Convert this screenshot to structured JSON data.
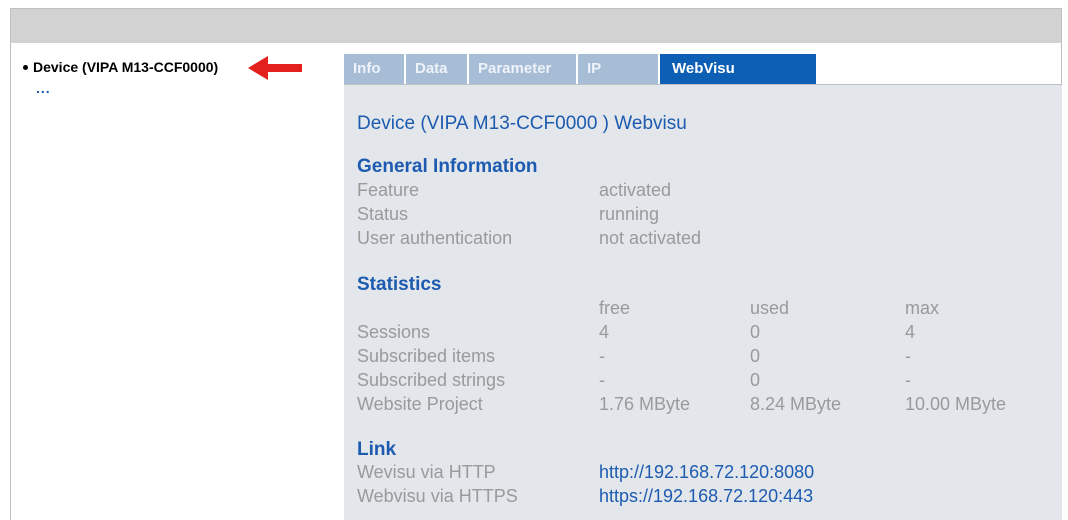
{
  "tree": {
    "device": "Device (VIPA M13-CCF0000)",
    "more": "..."
  },
  "tabs": [
    "Info",
    "Data",
    "Parameter",
    "IP",
    "WebVisu"
  ],
  "active_tab": "WebVisu",
  "panel": {
    "title": "Device (VIPA M13-CCF0000 ) Webvisu",
    "general": {
      "heading": "General Information",
      "rows": [
        {
          "label": "Feature",
          "value": "activated"
        },
        {
          "label": "Status",
          "value": "running"
        },
        {
          "label": "User authentication",
          "value": "not activated"
        }
      ]
    },
    "statistics": {
      "heading": "Statistics",
      "columns": [
        "free",
        "used",
        "max"
      ],
      "rows": [
        {
          "label": "Sessions",
          "free": "4",
          "used": "0",
          "max": "4"
        },
        {
          "label": "Subscribed items",
          "free": "-",
          "used": "0",
          "max": "-"
        },
        {
          "label": "Subscribed strings",
          "free": "-",
          "used": "0",
          "max": "-"
        },
        {
          "label": "Website Project",
          "free": "1.76 MByte",
          "used": "8.24 MByte",
          "max": "10.00 MByte"
        }
      ]
    },
    "links": {
      "heading": "Link",
      "rows": [
        {
          "label": "Wevisu via HTTP",
          "url": "http://192.168.72.120:8080"
        },
        {
          "label": "Webvisu via HTTPS",
          "url": "https://192.168.72.120:443"
        }
      ]
    }
  },
  "colors": {
    "accent": "#0d5fb5",
    "tab_inactive": "#a7bdd6",
    "panel_bg": "#e3e6ea",
    "arrow": "#e3201b"
  }
}
